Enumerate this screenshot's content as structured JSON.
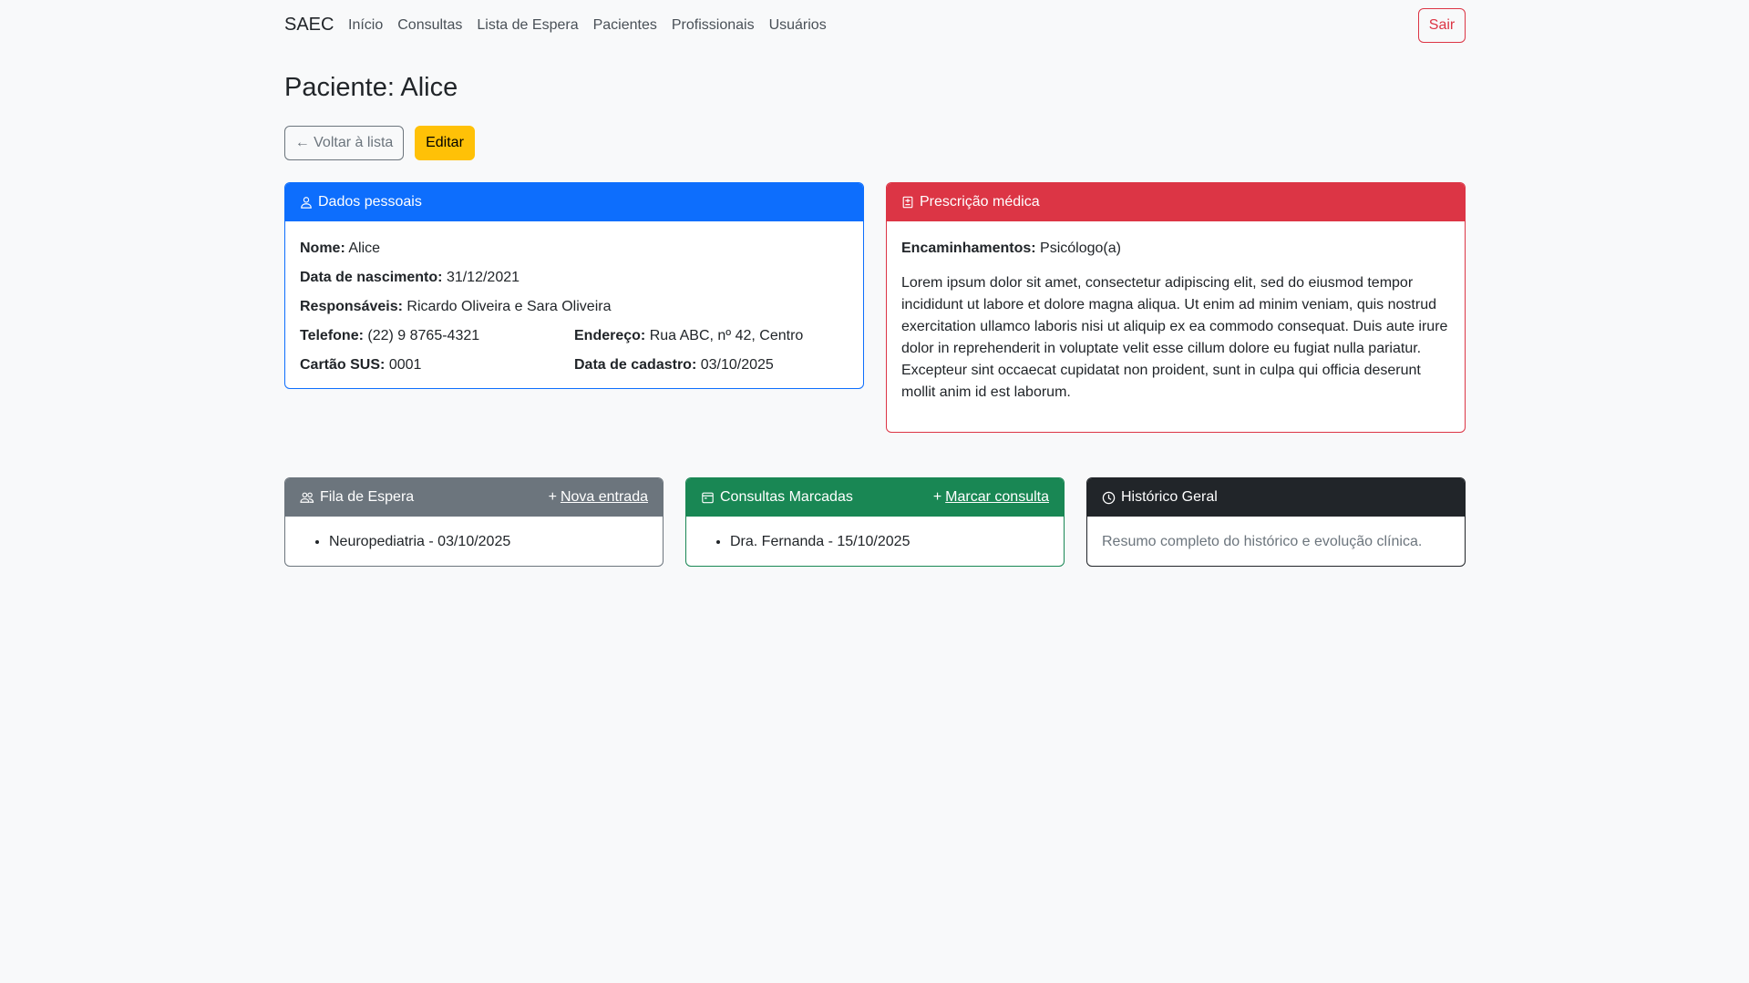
{
  "nav": {
    "brand": "SAEC",
    "links": [
      "Início",
      "Consultas",
      "Lista de Espera",
      "Pacientes",
      "Profissionais",
      "Usuários"
    ],
    "logout_label": "Sair"
  },
  "page": {
    "title": "Paciente: Alice",
    "back_label": "← Voltar à lista",
    "edit_label": "Editar"
  },
  "personal": {
    "header": "Dados pessoais",
    "name_label": "Nome:",
    "name": "Alice",
    "birth_label": "Data de nascimento:",
    "birth": "31/12/2021",
    "guardians_label": "Responsáveis:",
    "guardians": "Ricardo Oliveira e Sara Oliveira",
    "phone_label": "Telefone:",
    "phone": "(22) 9 8765-4321",
    "address_label": "Endereço:",
    "address": "Rua ABC, nº 42, Centro",
    "sus_label": "Cartão SUS:",
    "sus": "0001",
    "registered_label": "Data de cadastro:",
    "registered": "03/10/2025"
  },
  "prescription": {
    "header": "Prescrição médica",
    "referrals_label": "Encaminhamentos:",
    "referrals": "Psicólogo(a)",
    "text": "Lorem ipsum dolor sit amet, consectetur adipiscing elit, sed do eiusmod tempor incididunt ut labore et dolore magna aliqua. Ut enim ad minim veniam, quis nostrud exercitation ullamco laboris nisi ut aliquip ex ea commodo consequat. Duis aute irure dolor in reprehenderit in voluptate velit esse cillum dolore eu fugiat nulla pariatur. Excepteur sint occaecat cupidatat non proident, sunt in culpa qui officia deserunt mollit anim id est laborum."
  },
  "queue": {
    "header": "Fila de Espera",
    "action": "Nova entrada",
    "items": [
      "Neuropediatria - 03/10/2025"
    ]
  },
  "appointments": {
    "header": "Consultas Marcadas",
    "action": "Marcar consulta",
    "items": [
      "Dra. Fernanda - 15/10/2025"
    ]
  },
  "history": {
    "header": "Histórico Geral",
    "text": "Resumo completo do histórico e evolução clínica."
  },
  "colors": {
    "primary": "#0d6efd",
    "danger": "#dc3545",
    "secondary": "#6c757d",
    "success": "#198754",
    "dark": "#212529",
    "warning": "#ffc107"
  },
  "icons": [
    "person-icon",
    "prescription-icon",
    "people-icon",
    "calendar-icon",
    "clock-icon",
    "plus-icon"
  ]
}
